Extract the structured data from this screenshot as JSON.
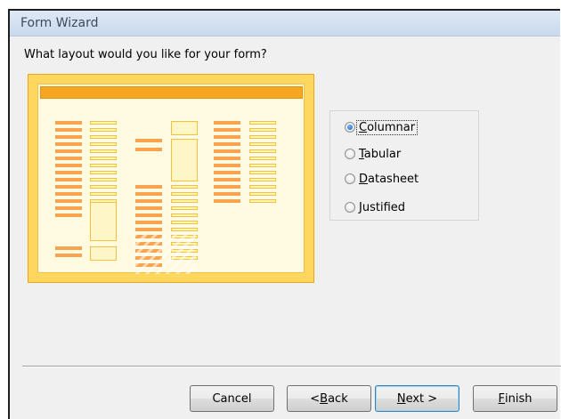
{
  "window": {
    "title": "Form Wizard"
  },
  "prompt": "What layout would you like for your form?",
  "layout_options": [
    {
      "label": "Columnar",
      "mnemonic": "C",
      "selected": true
    },
    {
      "label": "Tabular",
      "mnemonic": "T",
      "selected": false
    },
    {
      "label": "Datasheet",
      "mnemonic": "D",
      "selected": false
    },
    {
      "label": "Justified",
      "mnemonic": "J",
      "selected": false
    }
  ],
  "buttons": {
    "cancel": "Cancel",
    "back": "< Back",
    "next": "Next >",
    "finish": "Finish"
  },
  "colors": {
    "preview_frame": "#ffd75e",
    "preview_header": "#f5a623",
    "label_block": "#f7a350",
    "field_block": "#fff6c8"
  }
}
